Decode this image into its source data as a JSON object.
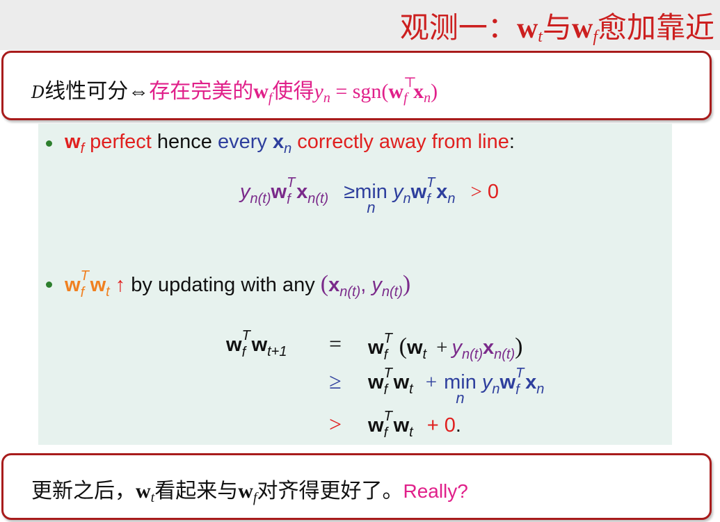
{
  "header": {
    "title_prefix": "观测一：",
    "title_w": "w",
    "title_t": "t",
    "title_mid": "与",
    "title_f": "f",
    "title_suffix": "愈加靠近"
  },
  "box1": {
    "D": "D",
    "text1": "线性可分⇔",
    "text2": "存在完美的",
    "w": "w",
    "f": "f",
    "text3": "使得",
    "y": "y",
    "n": "n",
    "eq": " = sgn(",
    "top": "⊤",
    "x": "x",
    "close": ")"
  },
  "bullet1": {
    "w": "w",
    "f": "f",
    "perfect": " perfect",
    "hence": " hence ",
    "every": "every ",
    "x": "x",
    "n": "n",
    "correctly": " correctly away from line",
    "colon": ":"
  },
  "eq1": {
    "y": "y",
    "nt": "n(t)",
    "w": "w",
    "T": "T",
    "f": "f",
    "x": "x",
    "ge": "≥",
    "min": "min",
    "n": "n",
    "gt": ">",
    "zero": "0"
  },
  "bullet2": {
    "w": "w",
    "T": "T",
    "f": "f",
    "t": "t",
    "arrow": " ↑",
    "text": " by updating with any ",
    "lp": "(",
    "x": "x",
    "nt": "n(t)",
    "comma": ", ",
    "y": "y",
    "rp": ")"
  },
  "eq2": {
    "lhs_w": "w",
    "T": "T",
    "f": "f",
    "t1": "t+1",
    "eq": "=",
    "ge": "≥",
    "gt": ">",
    "t": "t",
    "lp": "(",
    "plus": "+",
    "y": "y",
    "nt": "n(t)",
    "x": "x",
    "rp": ")",
    "min": "min",
    "n": "n",
    "zero": "+ 0",
    "period": "."
  },
  "box2": {
    "text1": "更新之后，",
    "w": "w",
    "t": "t",
    "text2": "看起来与",
    "f": "f",
    "text3": "对齐得更好了。",
    "really": "Really?"
  }
}
